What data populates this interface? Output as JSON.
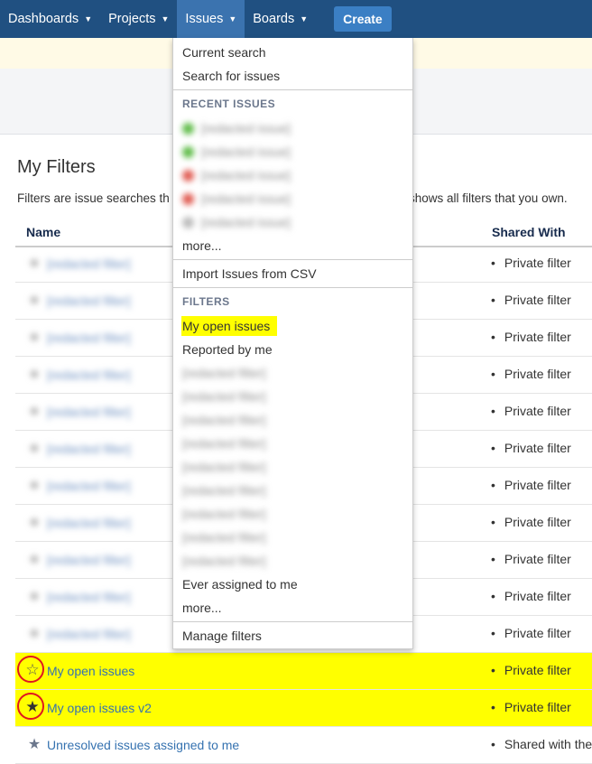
{
  "nav": {
    "items": [
      "Dashboards",
      "Projects",
      "Issues",
      "Boards"
    ],
    "create_label": "Create",
    "active": "Issues"
  },
  "page": {
    "title": "My Filters",
    "description_left": "Filters are issue searches th",
    "description_right": "shows all filters that you own.",
    "col_name": "Name",
    "col_shared": "Shared With"
  },
  "rows": [
    {
      "name": "[redacted filter]",
      "shared": "Private filter",
      "blurred": true
    },
    {
      "name": "[redacted filter]",
      "shared": "Private filter",
      "blurred": true
    },
    {
      "name": "[redacted filter]",
      "shared": "Private filter",
      "blurred": true
    },
    {
      "name": "[redacted filter]",
      "shared": "Private filter",
      "blurred": true
    },
    {
      "name": "[redacted filter]",
      "shared": "Private filter",
      "blurred": true
    },
    {
      "name": "[redacted filter]",
      "shared": "Private filter",
      "blurred": true
    },
    {
      "name": "[redacted filter]",
      "shared": "Private filter",
      "blurred": true
    },
    {
      "name": "[redacted filter]",
      "shared": "Private filter",
      "blurred": true
    },
    {
      "name": "[redacted filter]",
      "shared": "Private filter",
      "blurred": true
    },
    {
      "name": "[redacted filter]",
      "shared": "Private filter",
      "blurred": true
    },
    {
      "name": "[redacted filter]",
      "shared": "Private filter",
      "blurred": true
    },
    {
      "name": "My open issues",
      "shared": "Private filter",
      "star": "empty",
      "highlight": true
    },
    {
      "name": "My open issues v2",
      "shared": "Private filter",
      "star": "filled",
      "highlight": true
    },
    {
      "name": "Unresolved issues assigned to me",
      "shared": "Shared with the",
      "star": "filled"
    }
  ],
  "dropdown": {
    "current_search": "Current search",
    "search_for_issues": "Search for issues",
    "recent_heading": "RECENT ISSUES",
    "recent_issues": [
      {
        "text": "[redacted issue]",
        "status_color": "#5dbb46"
      },
      {
        "text": "[redacted issue]",
        "status_color": "#5dbb46"
      },
      {
        "text": "[redacted issue]",
        "status_color": "#e05a50"
      },
      {
        "text": "[redacted issue]",
        "status_color": "#e05a50"
      },
      {
        "text": "[redacted issue]",
        "status_color": "#bbbbbb"
      }
    ],
    "more_recent": "more...",
    "import_csv": "Import Issues from CSV",
    "filters_heading": "FILTERS",
    "my_open_issues": "My open issues",
    "reported_by_me": "Reported by me",
    "blurred_filters": [
      "[redacted filter]",
      "[redacted filter]",
      "[redacted filter]",
      "[redacted filter]",
      "[redacted filter]",
      "[redacted filter]",
      "[redacted filter]",
      "[redacted filter]",
      "[redacted filter]"
    ],
    "ever_assigned": "Ever assigned to me",
    "more_filters": "more...",
    "manage_filters": "Manage filters"
  },
  "colors": {
    "nav_bg": "#205081",
    "nav_active": "#3b73af",
    "create_btn": "#3b7fc4",
    "link": "#3572b0",
    "highlight": "#ffff00",
    "annotation_ring": "#e0161f"
  }
}
